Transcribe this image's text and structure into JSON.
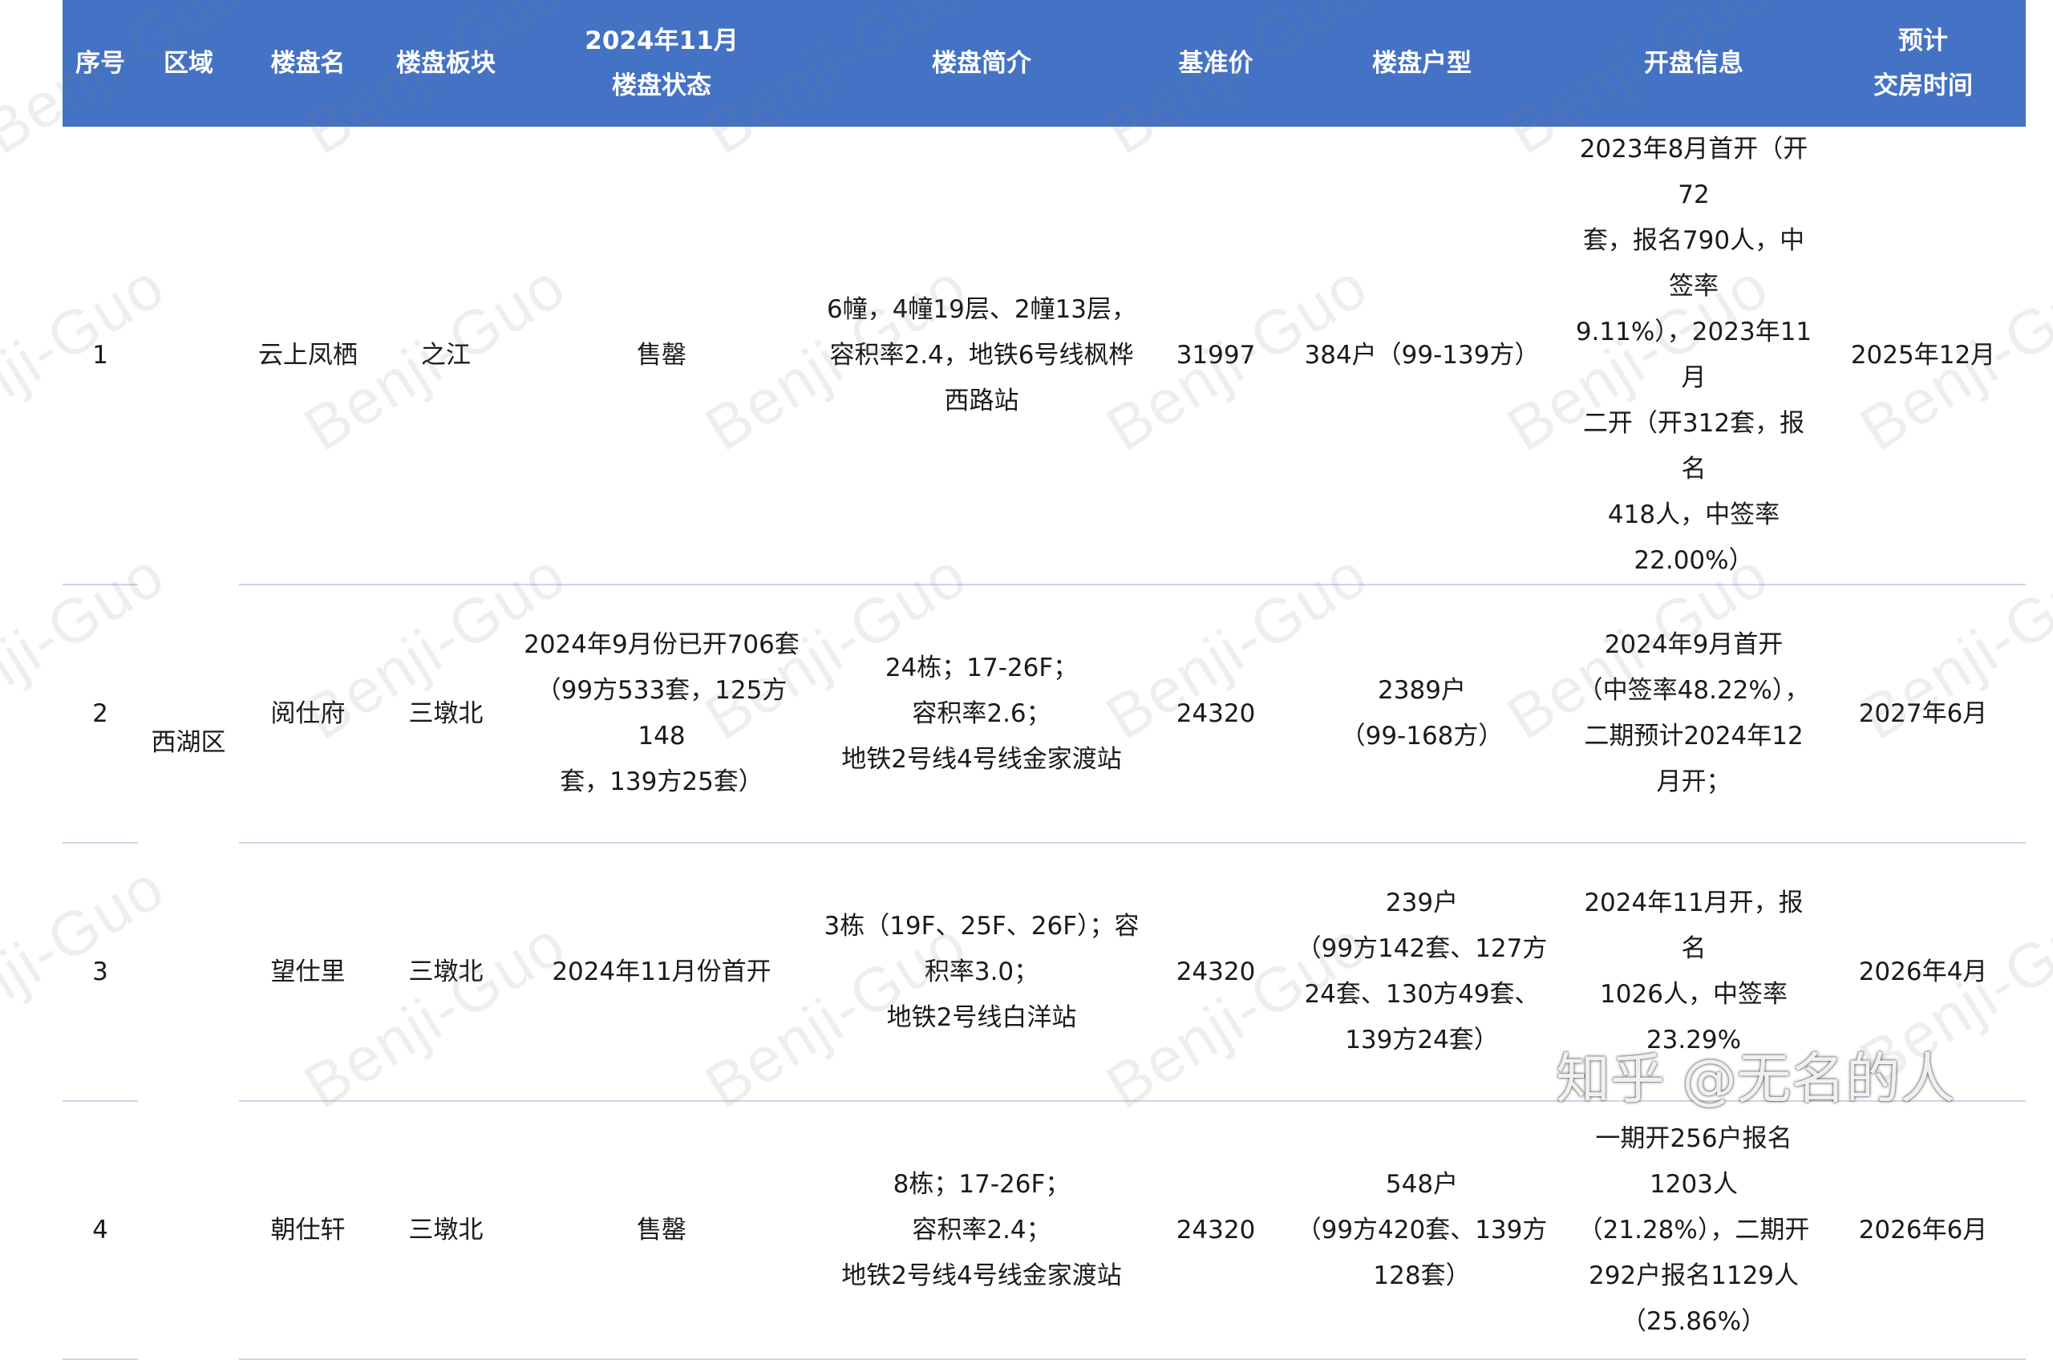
{
  "headers": [
    "序号",
    "区域",
    "楼盘名",
    "楼盘板块",
    [
      "2024年11月",
      "楼盘状态"
    ],
    "楼盘简介",
    "基准价",
    "楼盘户型",
    "开盘信息",
    [
      "预计",
      "交房时间"
    ]
  ],
  "region": "西湖区",
  "rows": [
    {
      "no": "1",
      "name": "云上凤栖",
      "block": "之江",
      "status": [
        "售罄"
      ],
      "intro": [
        "6幢，4幢19层、2幢13层，",
        "容积率2.4，地铁6号线枫桦",
        "西路站"
      ],
      "price": "31997",
      "units": [
        "384户（99-139方）"
      ],
      "open": [
        "2023年8月首开（开72",
        "套，报名790人，中签率",
        "9.11%），2023年11月",
        "二开（开312套，报名",
        "418人，中签率22.00%）"
      ],
      "delivery": "2025年12月"
    },
    {
      "no": "2",
      "name": "阅仕府",
      "block": "三墩北",
      "status": [
        "2024年9月份已开706套",
        "（99方533套，125方148",
        "套，139方25套）"
      ],
      "intro": [
        "24栋；17-26F；",
        "容积率2.6；",
        "地铁2号线4号线金家渡站"
      ],
      "price": "24320",
      "units": [
        "2389户",
        "（99-168方）"
      ],
      "open": [
        "2024年9月首开",
        "（中签率48.22%），",
        "二期预计2024年12月开；"
      ],
      "delivery": "2027年6月"
    },
    {
      "no": "3",
      "name": "望仕里",
      "block": "三墩北",
      "status": [
        "2024年11月份首开"
      ],
      "intro": [
        "3栋（19F、25F、26F）；容",
        "积率3.0；",
        "地铁2号线白洋站"
      ],
      "price": "24320",
      "units": [
        "239户",
        "（99方142套、127方",
        "24套、130方49套、",
        "139方24套）"
      ],
      "open": [
        "2024年11月开，报名",
        "1026人，中签率23.29%"
      ],
      "delivery": "2026年4月"
    },
    {
      "no": "4",
      "name": "朝仕轩",
      "block": "三墩北",
      "status": [
        "售罄"
      ],
      "intro": [
        "8栋；17-26F；",
        "容积率2.4；",
        "地铁2号线4号线金家渡站"
      ],
      "price": "24320",
      "units": [
        "548户",
        "（99方420套、139方",
        "128套）"
      ],
      "open": [
        "一期开256户报名1203人",
        "（21.28%），二期开",
        "292户报名1129人",
        "（25.86%）"
      ],
      "delivery": "2026年6月"
    }
  ],
  "watermark": "Benji-Guo",
  "zhihu_watermark": "知乎 @无名的人"
}
